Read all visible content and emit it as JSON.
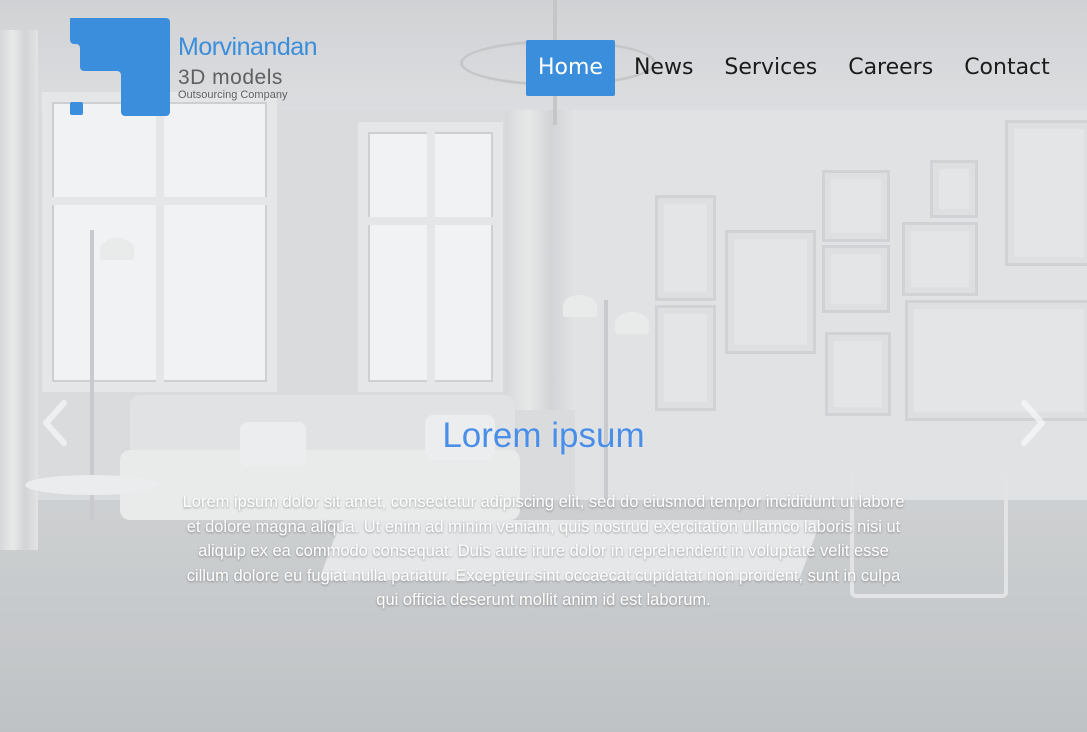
{
  "logo": {
    "name": "Morvinandan",
    "tagline": "3D models",
    "subtitle": "Outsourcing Company",
    "color": "#3b8edb"
  },
  "nav": {
    "items": [
      {
        "label": "Home",
        "active": true
      },
      {
        "label": "News",
        "active": false
      },
      {
        "label": "Services",
        "active": false
      },
      {
        "label": "Careers",
        "active": false
      },
      {
        "label": "Contact",
        "active": false
      }
    ],
    "active_color": "#3b8edb"
  },
  "carousel": {
    "title": "Lorem ipsum",
    "body": "Lorem ipsum dolor sit amet, consectetur adipiscing elit, sed do eiusmod tempor incididunt ut labore et dolore magna aliqua. Ut enim ad minim veniam, quis nostrud exercitation ullamco laboris nisi ut aliquip ex ea commodo consequat. Duis aute irure dolor in reprehenderit in voluptate velit esse cillum dolore eu fugiat nulla pariatur. Excepteur sint occaecat cupidatat non proident, sunt in culpa qui officia deserunt mollit anim id est laborum.",
    "prev_icon": "chevron-left-icon",
    "next_icon": "chevron-right-icon",
    "title_color": "#4a8ee8"
  }
}
